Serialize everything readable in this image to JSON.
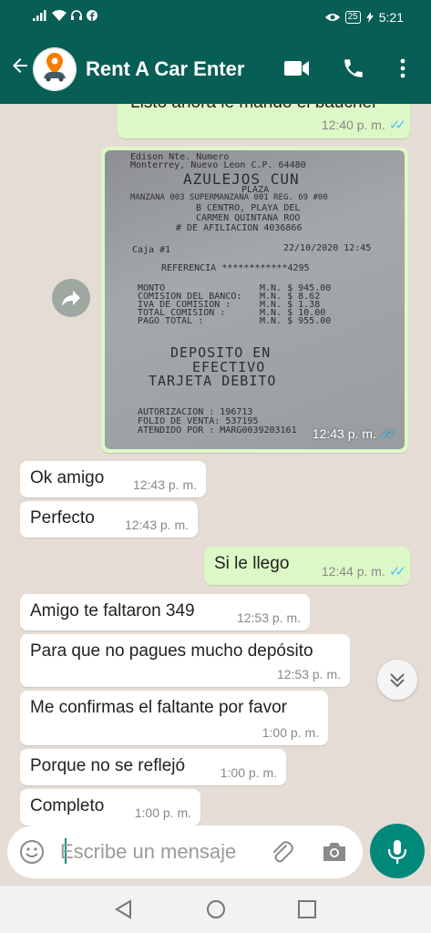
{
  "status_bar": {
    "time": "5:21",
    "battery": "25"
  },
  "header": {
    "contact_name": "Rent A Car Enter"
  },
  "messages": [
    {
      "text": "Listo ahora le mando el baucher",
      "time": "12:40 p. m."
    },
    {
      "image_time": "12:43 p. m."
    },
    {
      "text": "Ok amigo",
      "time": "12:43 p. m."
    },
    {
      "text": "Perfecto",
      "time": "12:43 p. m."
    },
    {
      "text": "Si le llego",
      "time": "12:44 p. m."
    },
    {
      "text": "Amigo te faltaron 349",
      "time": "12:53 p. m."
    },
    {
      "text": "Para que no pagues mucho depósito",
      "time": "12:53 p. m."
    },
    {
      "text": "Me confirmas el faltante por favor",
      "time": "1:00 p. m."
    },
    {
      "text": "Porque no se reflejó",
      "time": "1:00 p. m."
    },
    {
      "text": "Completo",
      "time": "1:00 p. m."
    }
  ],
  "receipt": {
    "line1": "Edison Nte. Numero",
    "line2": "Monterrey, Nuevo Leon C.P. 64480",
    "store": "AZULEJOS CUN",
    "plaza": "PLAZA",
    "addr1": "MANZANA 003 SUPERMANZANA 001 REG. 69 #00",
    "addr2": "B CENTRO, PLAYA DEL",
    "addr3": "CARMEN QUINTANA ROO",
    "affil": "# DE AFILIACION 4036866",
    "caja": "Caja #1",
    "date": "22/10/2020 12:45",
    "ref": "REFERENCIA ************4295",
    "monto_label": "MONTO",
    "monto": "M.N. $    945.00",
    "comision_label": "COMISION DEL BANCO:",
    "comision": "M.N. $      8.62",
    "iva_label": "IVA DE COMISION   :",
    "iva": "M.N. $      1.38",
    "total_com_label": "TOTAL COMISION    :",
    "total_com": "M.N. $     10.00",
    "pago_label": "PAGO TOTAL        :",
    "pago": "M.N. $    955.00",
    "dep1": "DEPOSITO EN",
    "dep2": "EFECTIVO",
    "dep3": "TARJETA DEBITO",
    "aut": "AUTORIZACION  :  196713",
    "folio": "FOLIO DE VENTA:  537195",
    "atendido": "ATENDIDO POR  :  MARG0039203161"
  },
  "input": {
    "placeholder": "Escribe un mensaje"
  },
  "colors": {
    "header": "#075e54",
    "outgoing": "#dcf8c6",
    "incoming": "#ffffff",
    "read_check": "#4fc3f7",
    "mic": "#00897b"
  }
}
